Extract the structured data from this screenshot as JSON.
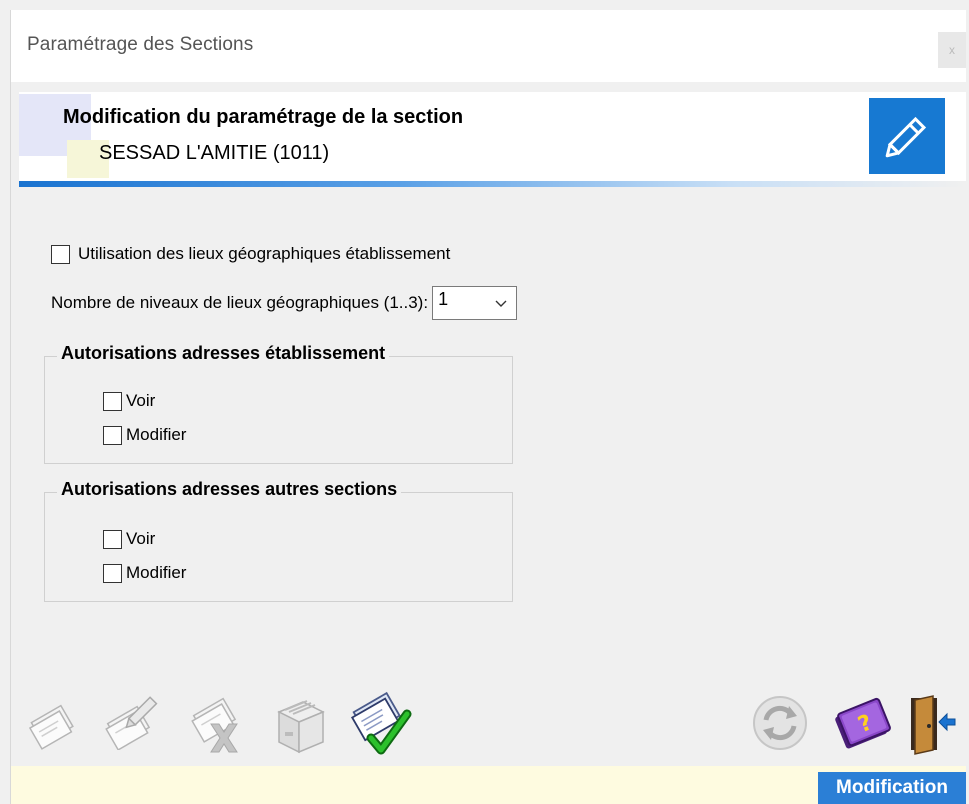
{
  "window": {
    "title": "Paramétrage des Sections",
    "close_label": "x"
  },
  "header": {
    "heading": "Modification du paramétrage de la section",
    "section_name": "SESSAD L'AMITIE (1011)",
    "icon": "pencil-icon"
  },
  "form": {
    "geo_places_label": "Utilisation des lieux géographiques établissement",
    "geo_places_checked": false,
    "levels_label": "Nombre de niveaux de lieux géographiques (1..3):",
    "levels_value": "1"
  },
  "groups": [
    {
      "title": "Autorisations adresses établissement",
      "options": [
        {
          "label": "Voir",
          "checked": false
        },
        {
          "label": "Modifier",
          "checked": false
        }
      ]
    },
    {
      "title": "Autorisations adresses autres sections",
      "options": [
        {
          "label": "Voir",
          "checked": false
        },
        {
          "label": "Modifier",
          "checked": false
        }
      ]
    }
  ],
  "toolbar": {
    "left_icons": [
      "new-document-icon",
      "edit-document-icon",
      "delete-document-icon",
      "file-drawer-icon",
      "validate-document-icon"
    ],
    "right_icons": [
      "refresh-icon",
      "help-book-icon",
      "exit-door-icon"
    ]
  },
  "colors": {
    "accent": "#1779d2",
    "status_bg": "#fefbe0",
    "validate_check": "#1aa01a"
  },
  "status": {
    "mode": "Modification"
  }
}
